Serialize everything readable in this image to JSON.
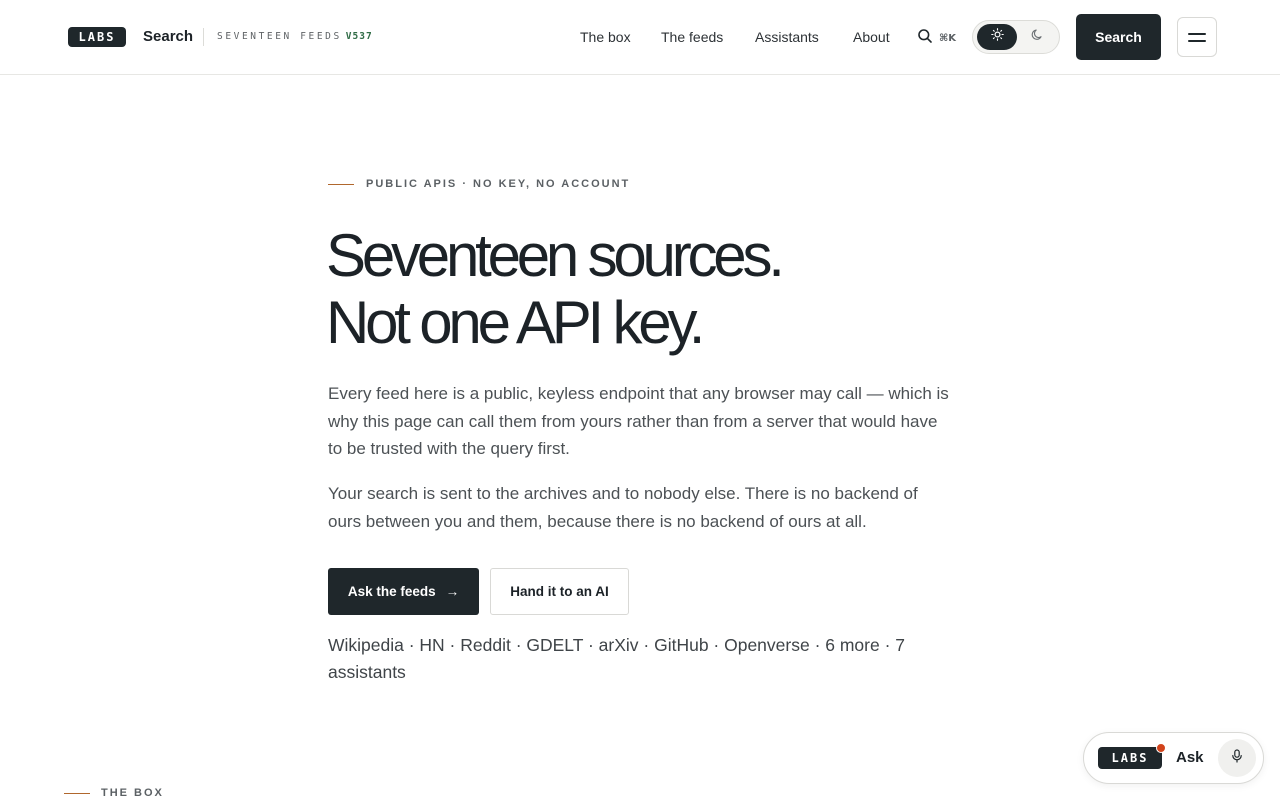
{
  "header": {
    "logo_text": "LABS",
    "brand": "Search",
    "tagline": "SEVENTEEN FEEDS",
    "version": "V537",
    "nav": [
      "The box",
      "The feeds",
      "Assistants",
      "About"
    ],
    "search_shortcut": "⌘K",
    "search_button": "Search",
    "theme": "light",
    "icons": {
      "search": "search-icon",
      "light": "sun-icon",
      "dark": "moon-icon",
      "menu": "hamburger-menu-icon"
    }
  },
  "hero": {
    "eyebrow": "PUBLIC APIS · NO KEY, NO ACCOUNT",
    "title_line1": "Seventeen sources.",
    "title_line2": "Not one API key.",
    "lede1": "Every feed here is a public, keyless endpoint that any browser may call — which is why this page can call them from yours rather than from a server that would have to be trusted with the query first.",
    "lede2": "Your search is sent to the archives and to nobody else. There is no backend of ours between you and them, because there is no backend of ours at all.",
    "primary_cta": "Ask the feeds",
    "primary_cta_arrow": "→",
    "secondary_cta": "Hand it to an AI",
    "sources_line": "Wikipedia · HN · Reddit · GDELT · arXiv · GitHub · Openverse · 6 more · 7 assistants"
  },
  "next_section": {
    "eyebrow": "THE BOX"
  },
  "ask_widget": {
    "logo_text": "LABS",
    "label": "Ask",
    "icon": "microphone-icon",
    "notification_color": "#d2431b"
  },
  "colors": {
    "ink": "#1f272b",
    "accent_rule": "#b0672d",
    "version_green": "#2f6b45"
  }
}
